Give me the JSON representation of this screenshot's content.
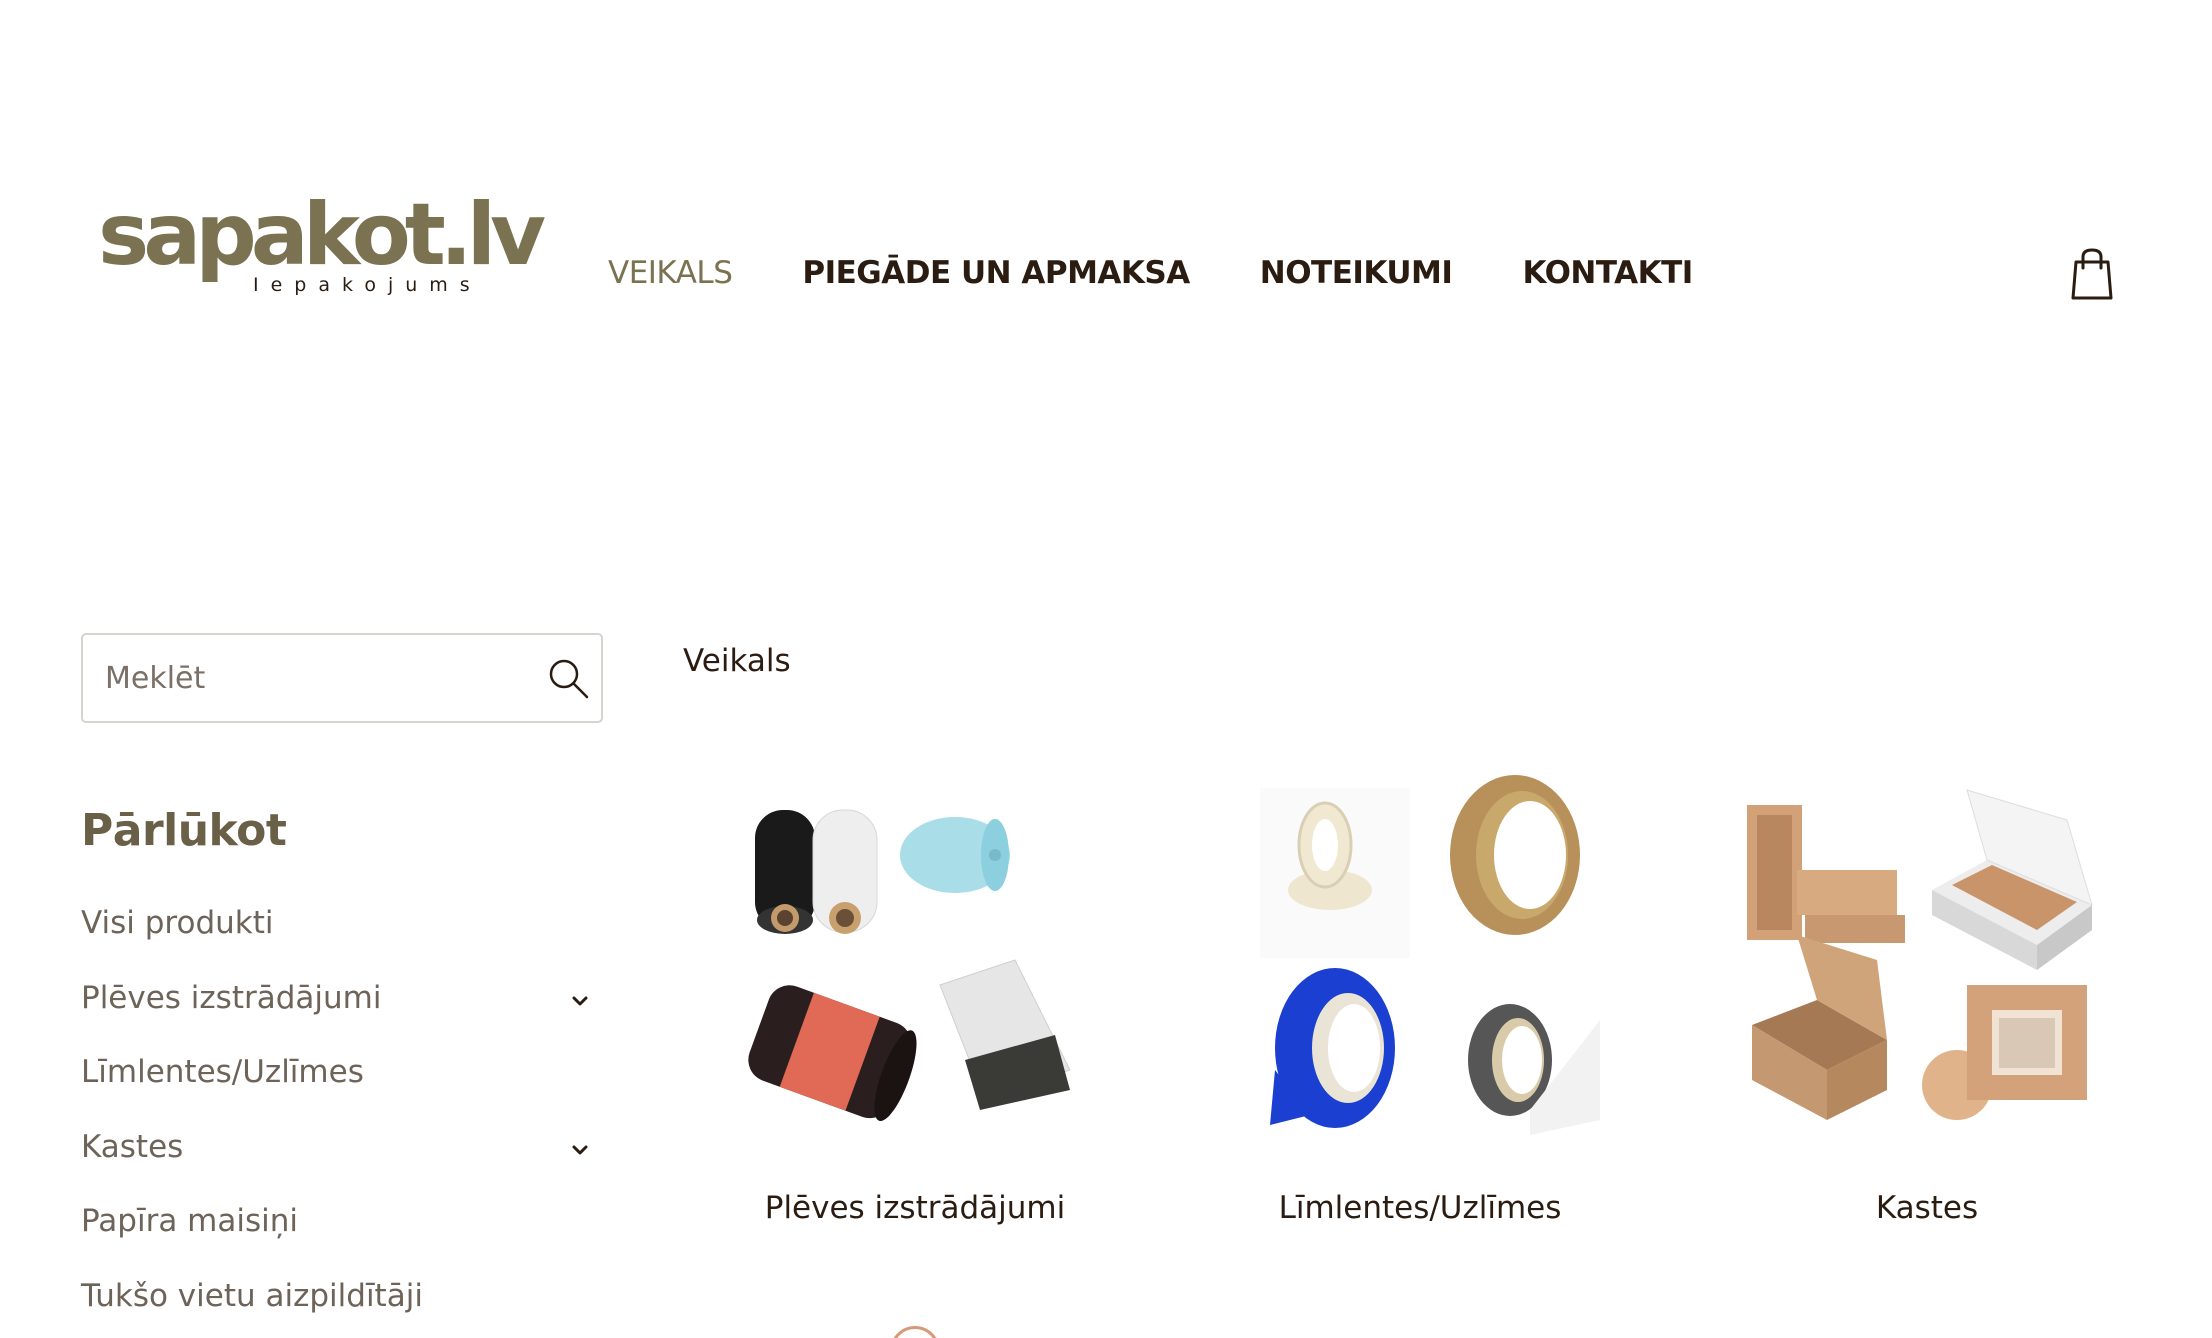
{
  "header": {
    "logo": {
      "main": "sapakot.lv",
      "sub": "Iepakojums"
    },
    "nav": [
      {
        "label": "VEIKALS",
        "active": true
      },
      {
        "label": "PIEGĀDE UN APMAKSA",
        "active": false
      },
      {
        "label": "NOTEIKUMI",
        "active": false
      },
      {
        "label": "KONTAKTI",
        "active": false
      }
    ],
    "cart_icon": "shopping-bag-icon"
  },
  "sidebar": {
    "search": {
      "placeholder": "Meklēt",
      "value": ""
    },
    "browse_title": "Pārlūkot",
    "categories": [
      {
        "label": "Visi produkti",
        "expandable": false
      },
      {
        "label": "Plēves izstrādājumi",
        "expandable": true
      },
      {
        "label": "Līmlentes/Uzlīmes",
        "expandable": false
      },
      {
        "label": "Kastes",
        "expandable": true
      },
      {
        "label": "Papīra maisiņi",
        "expandable": false
      },
      {
        "label": "Tukšo vietu aizpildītāji",
        "expandable": false
      }
    ]
  },
  "main": {
    "breadcrumb": "Veikals",
    "products": [
      {
        "label": "Plēves izstrādājumi"
      },
      {
        "label": "Līmlentes/Uzlīmes"
      },
      {
        "label": "Kastes"
      }
    ]
  },
  "colors": {
    "brand_olive": "#7a7251",
    "text_dark": "#2b1c12",
    "text_muted": "#6d6359"
  }
}
